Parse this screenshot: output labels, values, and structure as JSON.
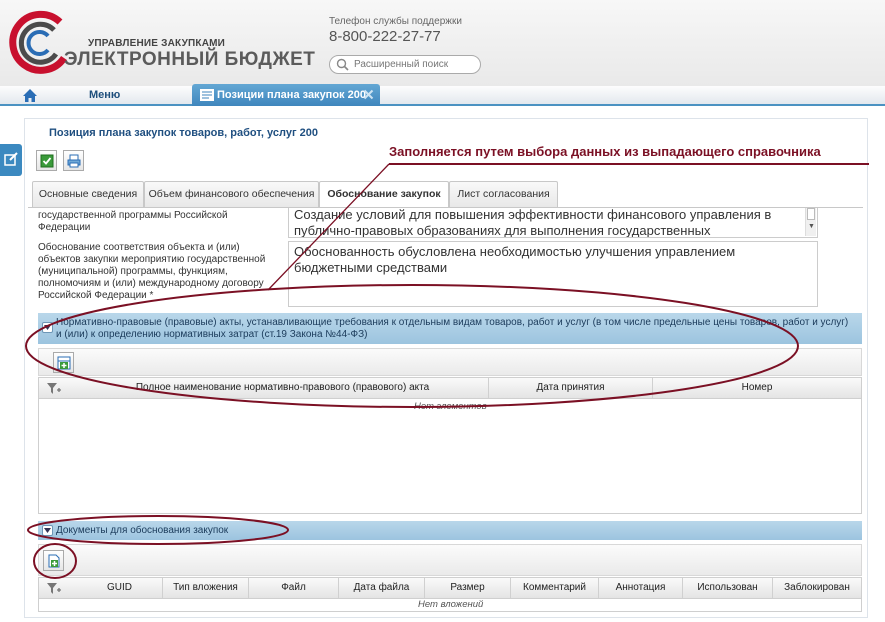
{
  "header": {
    "brand_sub": "УПРАВЛЕНИЕ ЗАКУПКАМИ",
    "brand_main": "ЭЛЕКТРОННЫЙ БЮДЖЕТ",
    "support_label": "Телефон службы поддержки",
    "support_phone": "8-800-222-27-77",
    "search_placeholder": "Расширенный поиск"
  },
  "nav": {
    "menu_label": "Меню",
    "active_tab": "Позиции плана закупок 200"
  },
  "page": {
    "title": "Позиция плана закупок товаров, работ, услуг 200"
  },
  "annotation": {
    "text": "Заполняется путем выбора данных из выпадающего справочника"
  },
  "tabs": [
    {
      "label": "Основные сведения"
    },
    {
      "label": "Объем финансового обеспечения"
    },
    {
      "label": "Обоснование закупок"
    },
    {
      "label": "Лист согласования"
    }
  ],
  "form": {
    "field1_label": "государственной программы Российской Федерации",
    "field1_value": "Создание условий для повышения эффективности финансового управления в публично-правовых образованиях для выполнения государственных",
    "field2_label": "Обоснование соответствия объекта и (или) объектов закупки мероприятию государственной (муниципальной) программы, функциям, полномочиям и (или) международному договору Российской Федерации *",
    "field2_value": "Обоснованность обусловлена необходимостью улучшения управлением бюджетными средствами"
  },
  "section1": {
    "title": "Нормативно-правовые (правовые) акты, устанавливающие требования к отдельным видам товаров, работ и услуг (в том числе предельные цены товаров, работ и услуг) и (или) к определению нормативных затрат (ст.19 Закона №44-ФЗ)",
    "columns": [
      "Полное наименование нормативно-правового (правового) акта",
      "Дата принятия",
      "Номер"
    ],
    "empty": "Нет элементов"
  },
  "section2": {
    "title": "Документы для обоснования закупок",
    "columns": [
      "GUID",
      "Тип вложения",
      "Файл",
      "Дата файла",
      "Размер",
      "Комментарий",
      "Аннотация",
      "Использован",
      "Заблокирован"
    ],
    "empty": "Нет вложений"
  },
  "colors": {
    "accent": "#3f86bd",
    "annotation": "#7b1024",
    "section_bar": "#9cc4df"
  }
}
